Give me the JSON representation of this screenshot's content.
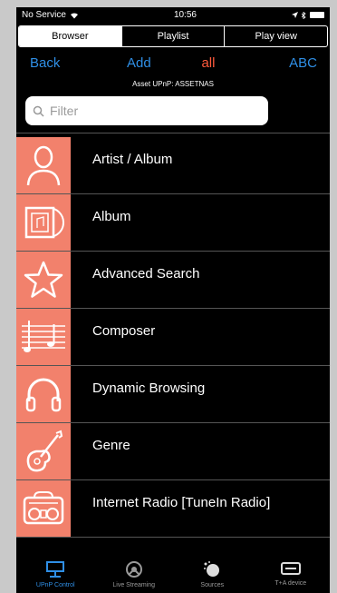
{
  "status": {
    "carrier": "No Service",
    "time": "10:56"
  },
  "segments": [
    {
      "label": "Browser",
      "active": true
    },
    {
      "label": "Playlist",
      "active": false
    },
    {
      "label": "Play view",
      "active": false
    }
  ],
  "nav": {
    "back": "Back",
    "add": "Add",
    "all": "all",
    "abc": "ABC"
  },
  "asset": "Asset UPnP: ASSETNAS",
  "filter": {
    "placeholder": "Filter",
    "value": ""
  },
  "items": [
    {
      "label": "Artist / Album",
      "icon": "person-icon"
    },
    {
      "label": "Album",
      "icon": "album-icon"
    },
    {
      "label": "Advanced Search",
      "icon": "star-icon"
    },
    {
      "label": "Composer",
      "icon": "sheet-music-icon"
    },
    {
      "label": "Dynamic Browsing",
      "icon": "headphones-icon"
    },
    {
      "label": "Genre",
      "icon": "guitar-icon"
    },
    {
      "label": "Internet Radio [TuneIn Radio]",
      "icon": "boombox-icon"
    }
  ],
  "tabs": [
    {
      "label": "UPnP Control",
      "active": true
    },
    {
      "label": "Live Streaming",
      "active": false
    },
    {
      "label": "Sources",
      "active": false
    },
    {
      "label": "T+A device",
      "active": false
    }
  ],
  "colors": {
    "accent": "#2f8fe6",
    "icon_bg": "#f2816c",
    "highlight": "#ff5a3c"
  }
}
